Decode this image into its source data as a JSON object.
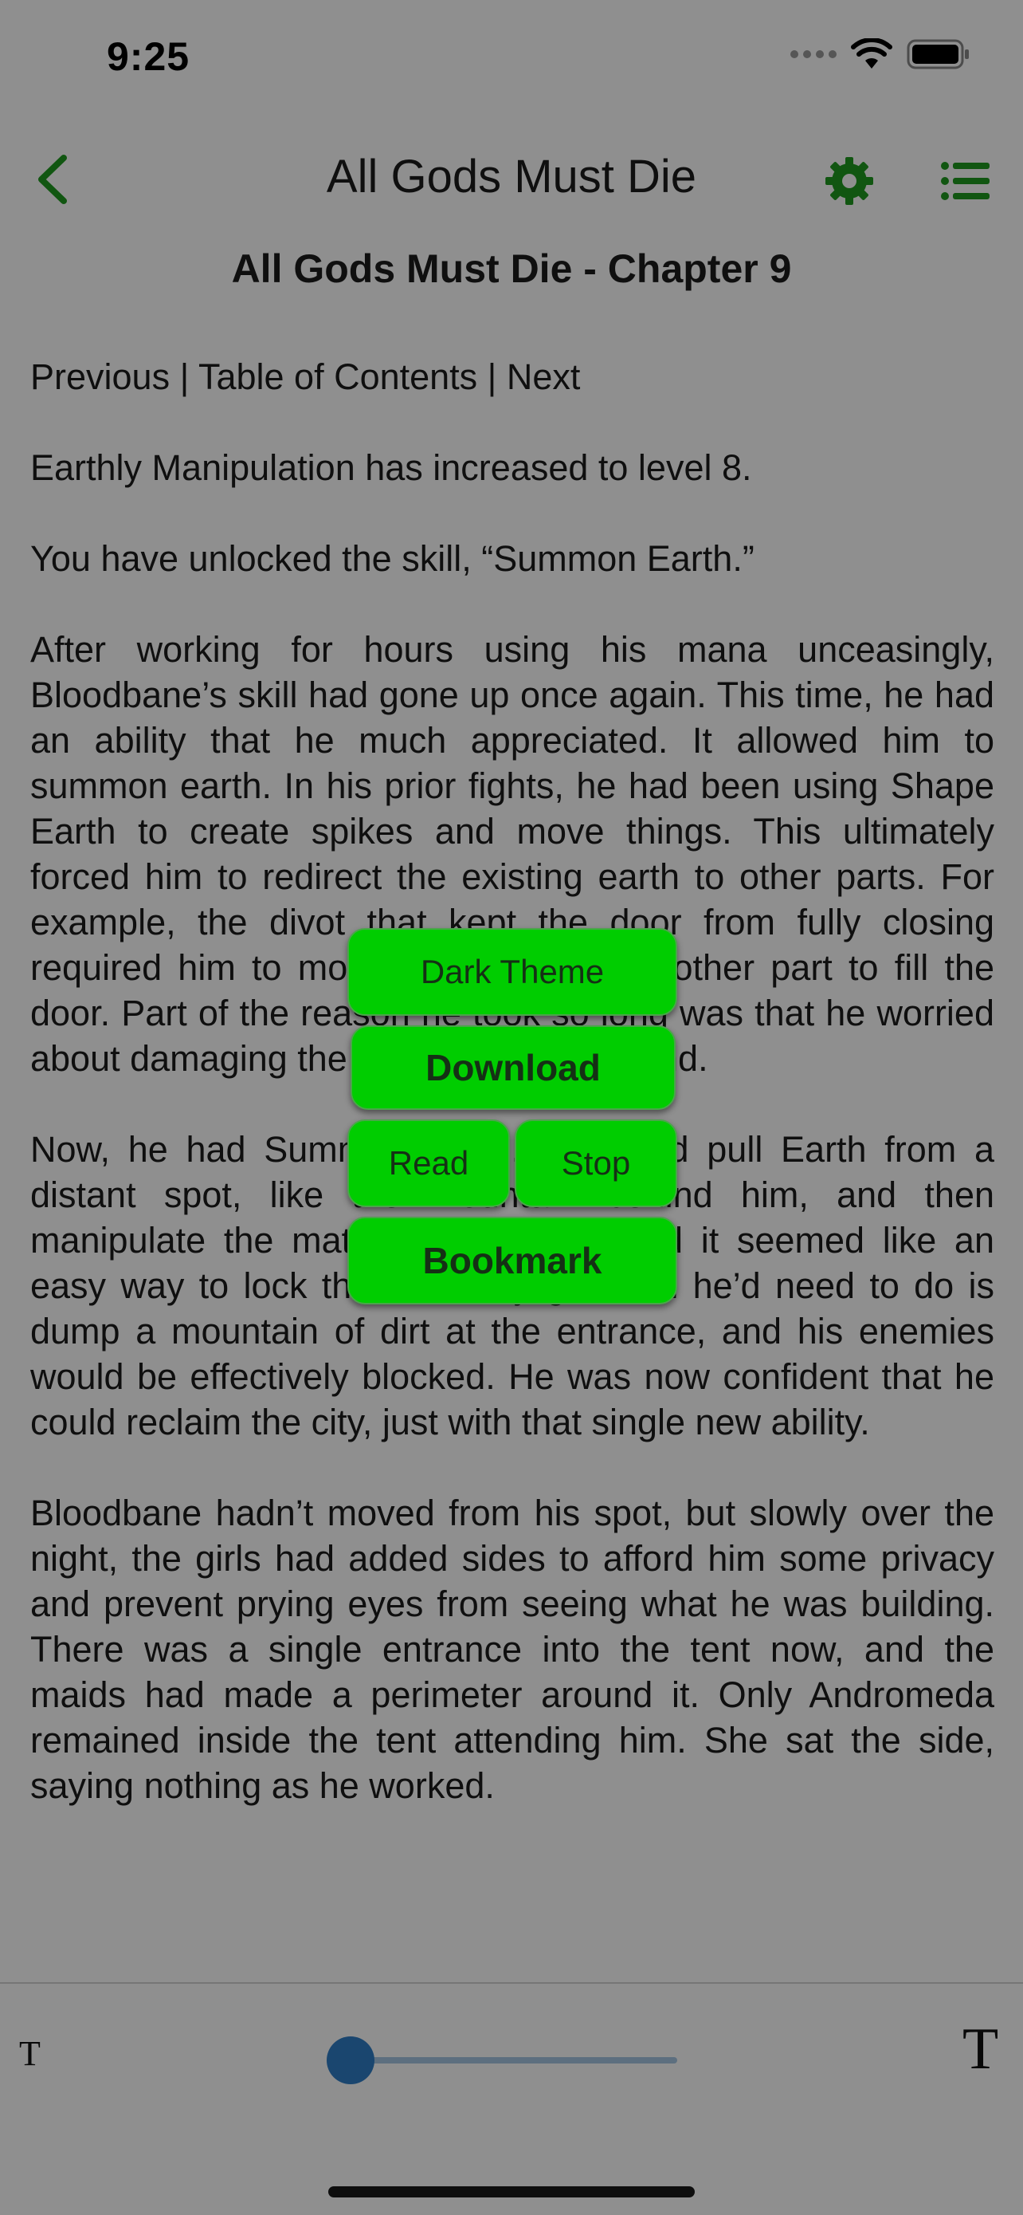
{
  "status_bar": {
    "time": "9:25",
    "icons": [
      "cellular-signal-icon",
      "wifi-icon",
      "battery-icon"
    ]
  },
  "nav": {
    "title": "All Gods Must Die",
    "back_icon": "chevron-left-icon",
    "settings_icon": "gear-icon",
    "list_icon": "list-icon"
  },
  "chapter_title": "All Gods Must Die - Chapter 9",
  "reader": {
    "paragraphs": [
      "Previous | Table of Contents | Next",
      "Earthly Manipulation has increased to level 8.",
      "You have unlocked the skill, “Summon Earth.”",
      "After working for hours using his mana unceasingly, Bloodbane’s skill had gone up once again. This time, he had an ability that he much appreciated. It allowed him to summon earth. In his prior fights, he had been using Shape Earth to create spikes and move things. This ultimately forced him to redirect the existing earth to other parts. For example, the divot that kept the door from fully closing required him to move material from another part to fill the door. Part of the reason he took so long was that he worried about damaging the stability of the ground.",
      "Now, he had Summon Earth. He could pull Earth from a distant spot, like the mountain behind him, and then manipulate the material here later, and it seemed like an easy way to lock the inner-city gate. All he’d need to do is dump a mountain of dirt at the entrance, and his enemies would be effectively blocked. He was now confident that he could reclaim the city, just with that single new ability.",
      "Bloodbane hadn’t moved from his spot, but slowly over the night, the girls had added sides to afford him some privacy and prevent prying eyes from seeing what he was building. There was a single entrance into the tent now, and the maids had made a perimeter around it. Only Andromeda remained inside the tent attending him. She sat the side, saying nothing as he worked."
    ]
  },
  "font_bar": {
    "small_label": "T",
    "large_label": "T",
    "font_size_fraction": 0.05
  },
  "popup_menu": {
    "dark_theme": "Dark Theme",
    "download": "Download",
    "read": "Read",
    "stop": "Stop",
    "bookmark": "Bookmark"
  },
  "colors": {
    "accent_green": "#1f9a1f",
    "menu_green": "#00cd00",
    "slider_blue": "#2f7ec7",
    "overlay": "rgba(0,0,0,0.44)"
  }
}
